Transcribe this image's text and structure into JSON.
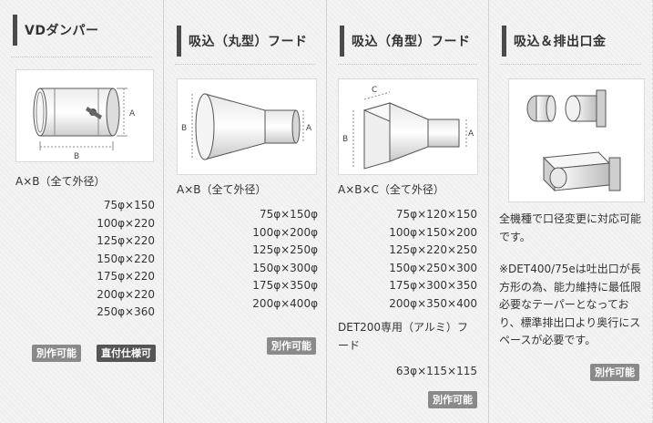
{
  "columns": [
    {
      "title": "VDダンパー",
      "spec": "A×B（全て外径）",
      "sizes": [
        "75φ×150",
        "100φ×220",
        "125φ×220",
        "150φ×220",
        "175φ×220",
        "200φ×220",
        "250φ×360"
      ],
      "badges": [
        "別作可能",
        "直付仕様可"
      ],
      "figure_labels": {
        "a": "A",
        "b": "B"
      }
    },
    {
      "title": "吸込（丸型）フード",
      "spec": "A×B（全て外径）",
      "sizes": [
        "75φ×150φ",
        "100φ×200φ",
        "125φ×250φ",
        "150φ×300φ",
        "175φ×350φ",
        "200φ×400φ"
      ],
      "badges": [
        "別作可能"
      ],
      "figure_labels": {
        "a": "A",
        "b": "B"
      }
    },
    {
      "title": "吸込（角型）フード",
      "spec": "A×B×C（全て外径）",
      "sizes": [
        "75φ×120×150",
        "100φ×150×200",
        "125φ×220×250",
        "150φ×250×300",
        "175φ×300×350",
        "200φ×350×400"
      ],
      "extra_text": "DET200専用（アルミ）フード",
      "extra_size": "63φ×115×115",
      "badges": [
        "別作可能"
      ],
      "figure_labels": {
        "a": "A",
        "b": "B",
        "c": "C"
      }
    },
    {
      "title": "吸込＆排出口金",
      "desc1": "全機種で口径変更に対応可能です。",
      "desc2": "※DET400/75eは吐出口が長方形の為、能力維持に最低限必要なテーパーとなっており、標準排出口より奥行にスペースが必要です。",
      "badges": [
        "別作可能"
      ]
    }
  ]
}
